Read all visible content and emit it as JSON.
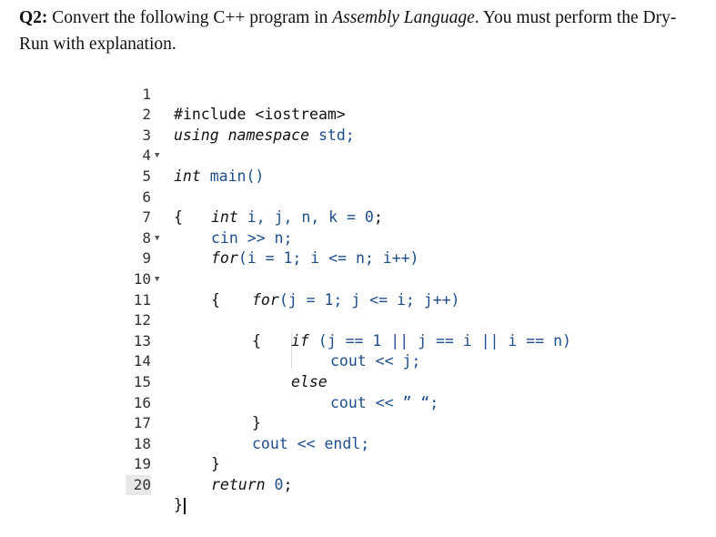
{
  "question": {
    "number": "Q2:",
    "part1": " Convert the following C++ program in ",
    "emphasis": "Assembly Language",
    "part2": ". You must perform the Dry-Run with explanation."
  },
  "code": {
    "line_numbers": [
      "1",
      "2",
      "3",
      "4",
      "5",
      "6",
      "7",
      "8",
      "9",
      "10",
      "11",
      "12",
      "13",
      "14",
      "15",
      "16",
      "17",
      "18",
      "19",
      "20"
    ],
    "l1": "#include <iostream>",
    "l2_kw": "using namespace",
    "l2_id": "std;",
    "l4_kw": "int",
    "l4_id": "main()",
    "l5": "{",
    "l6_kw": "int",
    "l6_rest_a": "i, j, n, k = ",
    "l6_num": "0",
    "l6_end": ";",
    "l7": "cin >> n;",
    "l8_kw": "for",
    "l8_rest": "(i = 1; i <= n; i++)",
    "l9": "{",
    "l10_kw": "for",
    "l10_rest": "(j = 1; j <= i; j++)",
    "l11": "{",
    "l12_kw": "if",
    "l12_rest": " (j == 1 || j == i || i == n)",
    "l13": "cout << j;",
    "l14_kw": "else",
    "l15": "cout << ” “;",
    "l16": "}",
    "l17": "cout << endl;",
    "l18": "}",
    "l19_kw": "return",
    "l19_num": "0",
    "l19_end": ";",
    "l20": "}"
  }
}
